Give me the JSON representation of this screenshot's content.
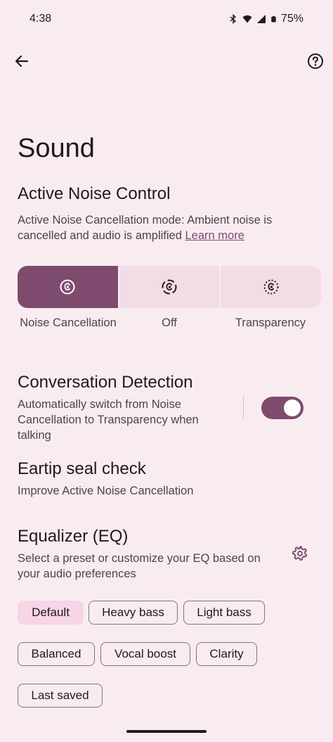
{
  "status_bar": {
    "time": "4:38",
    "battery": "75%",
    "icons": [
      "bluetooth-icon",
      "wifi-icon",
      "cell-signal-icon",
      "battery-icon"
    ]
  },
  "top_bar": {
    "back_icon": "arrow-left-icon",
    "help_icon": "help-circle-icon"
  },
  "page": {
    "title": "Sound"
  },
  "anc": {
    "title": "Active Noise Control",
    "desc": "Active Noise Cancellation mode: Ambient noise is cancelled and audio is amplified",
    "learn_more": "Learn more",
    "modes": [
      {
        "label": "Noise Cancellation",
        "icon": "noise-cancellation-icon",
        "selected": true
      },
      {
        "label": "Off",
        "icon": "anc-off-icon",
        "selected": false
      },
      {
        "label": "Transparency",
        "icon": "transparency-icon",
        "selected": false
      }
    ]
  },
  "conversation": {
    "title": "Conversation Detection",
    "desc": "Automatically switch from Noise Cancellation to Transparency when talking",
    "enabled": true
  },
  "seal": {
    "title": "Eartip seal check",
    "desc": "Improve Active Noise Cancellation"
  },
  "eq": {
    "title": "Equalizer (EQ)",
    "desc": "Select a preset or customize your EQ based on your audio preferences",
    "settings_icon": "gear-icon",
    "presets": [
      "Default",
      "Heavy bass",
      "Light bass",
      "Balanced",
      "Vocal boost",
      "Clarity",
      "Last saved"
    ],
    "selected": "Default"
  },
  "colors": {
    "background": "#f9ecf1",
    "accent": "#7e4a6d",
    "segment_bg": "#f2dce6",
    "chip_selected": "#f7d4e6"
  }
}
